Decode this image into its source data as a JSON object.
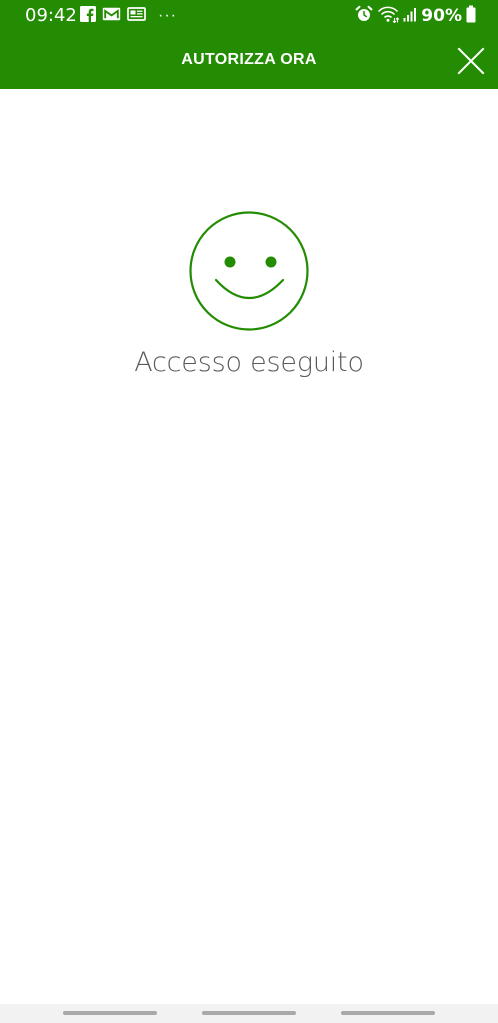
{
  "status_bar": {
    "time": "09:42",
    "more_indicator": "···",
    "battery_percent": "90%",
    "left_icons": [
      "facebook-icon",
      "gmail-icon",
      "news-icon"
    ],
    "right_icons": [
      "alarm-icon",
      "wifi-icon",
      "signal-icon",
      "battery-icon"
    ]
  },
  "header": {
    "title": "AUTORIZZA ORA",
    "close_icon": "close-icon"
  },
  "main": {
    "status_icon": "smiley-icon",
    "message": "Accesso eseguito"
  },
  "colors": {
    "brand_green": "#238c02",
    "text_gray": "#5a5a5a",
    "background": "#ffffff"
  }
}
